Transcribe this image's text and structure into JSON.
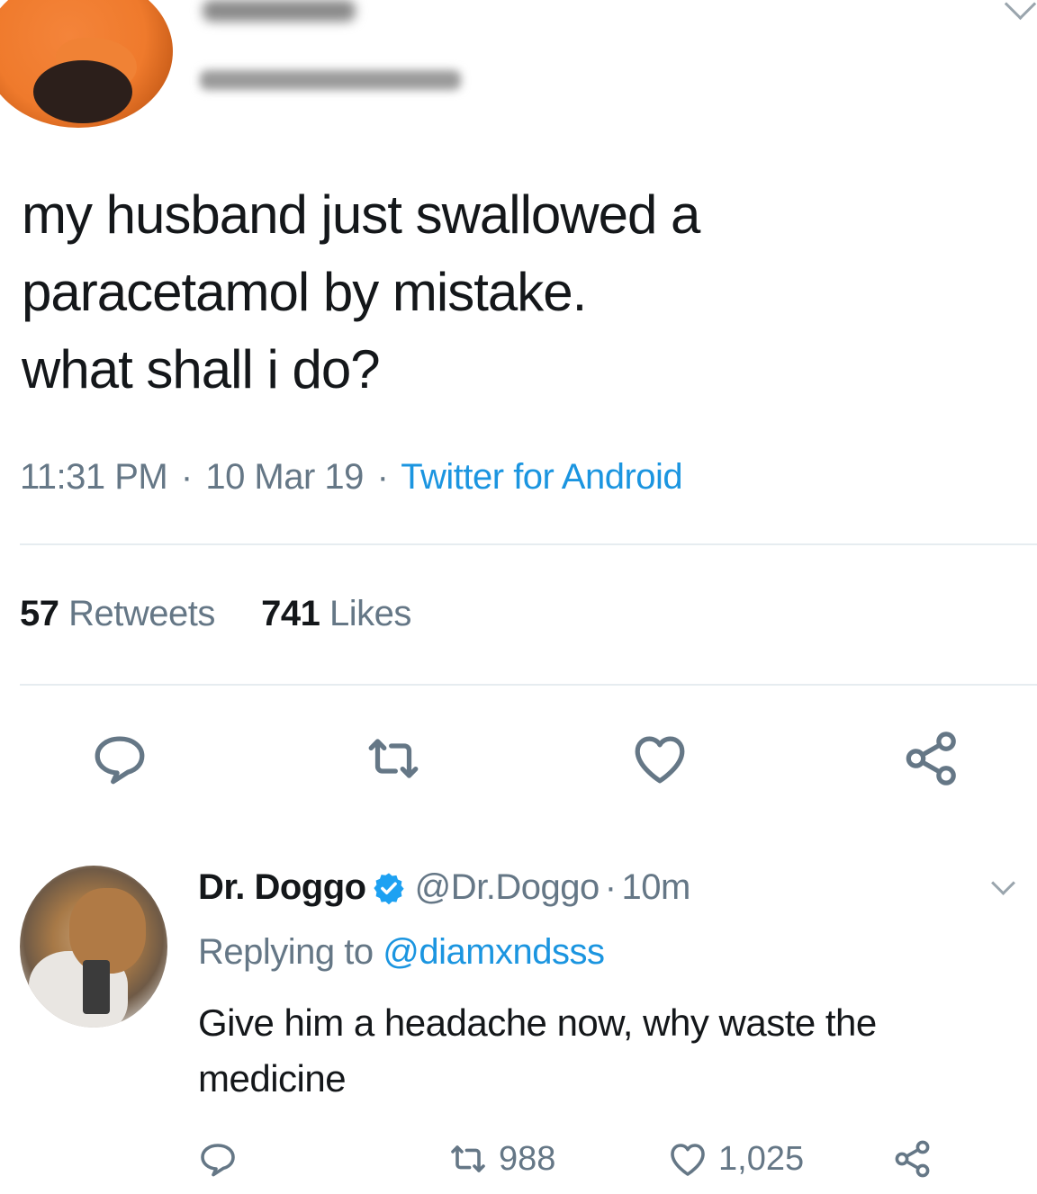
{
  "tweet": {
    "text_lines": [
      "my husband just swallowed a",
      "paracetamol by mistake.",
      "what shall i do?"
    ],
    "time": "11:31 PM",
    "date": "10 Mar 19",
    "source": "Twitter for Android",
    "separator": "·",
    "retweet_count": "57",
    "retweet_label": "Retweets",
    "like_count": "741",
    "like_label": "Likes"
  },
  "reply": {
    "author_name": "Dr. Doggo",
    "author_handle": "@Dr.Doggo",
    "separator": "·",
    "time": "10m",
    "replying_prefix": "Replying to",
    "replying_to": "@diamxndsss",
    "text_lines": [
      "Give him a headache now, why waste the",
      "medicine"
    ],
    "retweet_count": "988",
    "like_count": "1,025"
  },
  "icons": {
    "reply": "reply-icon",
    "retweet": "retweet-icon",
    "like": "heart-icon",
    "share": "share-icon",
    "verified": "verified-badge-icon",
    "caret": "chevron-down-icon"
  },
  "colors": {
    "link": "#1b95e0",
    "secondary_text": "#657786",
    "primary_text": "#14171a",
    "divider": "#e6ecf0",
    "icon": "#657786"
  }
}
